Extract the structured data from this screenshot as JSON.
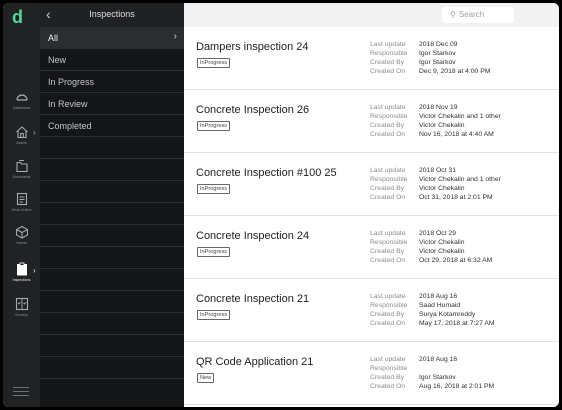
{
  "app": {
    "logo": "d",
    "title": "Inspections"
  },
  "rail": {
    "items": [
      {
        "label": "Dashboard",
        "icon": "dashboard-icon"
      },
      {
        "label": "Assets",
        "icon": "home-icon"
      },
      {
        "label": "Documents",
        "icon": "documents-icon"
      },
      {
        "label": "Work Orders",
        "icon": "work-orders-icon"
      },
      {
        "label": "Viewer",
        "icon": "cube-icon"
      },
      {
        "label": "Inspections",
        "icon": "clipboard-icon",
        "active": true
      },
      {
        "label": "Surveys",
        "icon": "surveys-icon"
      }
    ]
  },
  "filters": {
    "items": [
      "All",
      "New",
      "In Progress",
      "In Review",
      "Completed"
    ],
    "selected": "All"
  },
  "search": {
    "placeholder": "Search"
  },
  "meta_labels": {
    "last_update": "Last update",
    "responsible": "Responsible",
    "created_by": "Created By",
    "created_on": "Created On"
  },
  "inspections": [
    {
      "title": "Dampers inspection 24",
      "status": "InProgress",
      "last_update": "2018 Dec 09",
      "responsible": "Igor Starkov",
      "created_by": "Igor Starkov",
      "created_on": "Dec 9, 2018 at 4:00 PM"
    },
    {
      "title": "Concrete Inspection 26",
      "status": "InProgress",
      "last_update": "2018 Nov 19",
      "responsible": "Victor Chekalin and 1 other",
      "created_by": "Victor Chekalin",
      "created_on": "Nov 16, 2018 at 4:40 AM"
    },
    {
      "title": "Concrete Inspection #100 25",
      "status": "InProgress",
      "last_update": "2018 Oct 31",
      "responsible": "Victor Chekalin and 1 other",
      "created_by": "Victor Chekalin",
      "created_on": "Oct 31, 2018 at 2:01 PM"
    },
    {
      "title": "Concrete Inspection 24",
      "status": "InProgress",
      "last_update": "2018 Oct 29",
      "responsible": "Victor Chekalin",
      "created_by": "Victor Chekalin",
      "created_on": "Oct 29, 2018 at 6:32 AM"
    },
    {
      "title": "Concrete Inspection 21",
      "status": "InProgress",
      "last_update": "2018 Aug 16",
      "responsible": "Saad Humaid",
      "created_by": "Surya Kotamreddy",
      "created_on": "May 17, 2018 at 7:27 AM"
    },
    {
      "title": "QR Code Application 21",
      "status": "New",
      "last_update": "2018 Aug 16",
      "responsible": "",
      "created_by": "Igor Starkov",
      "created_on": "Aug 16, 2018 at 2:01 PM"
    }
  ]
}
